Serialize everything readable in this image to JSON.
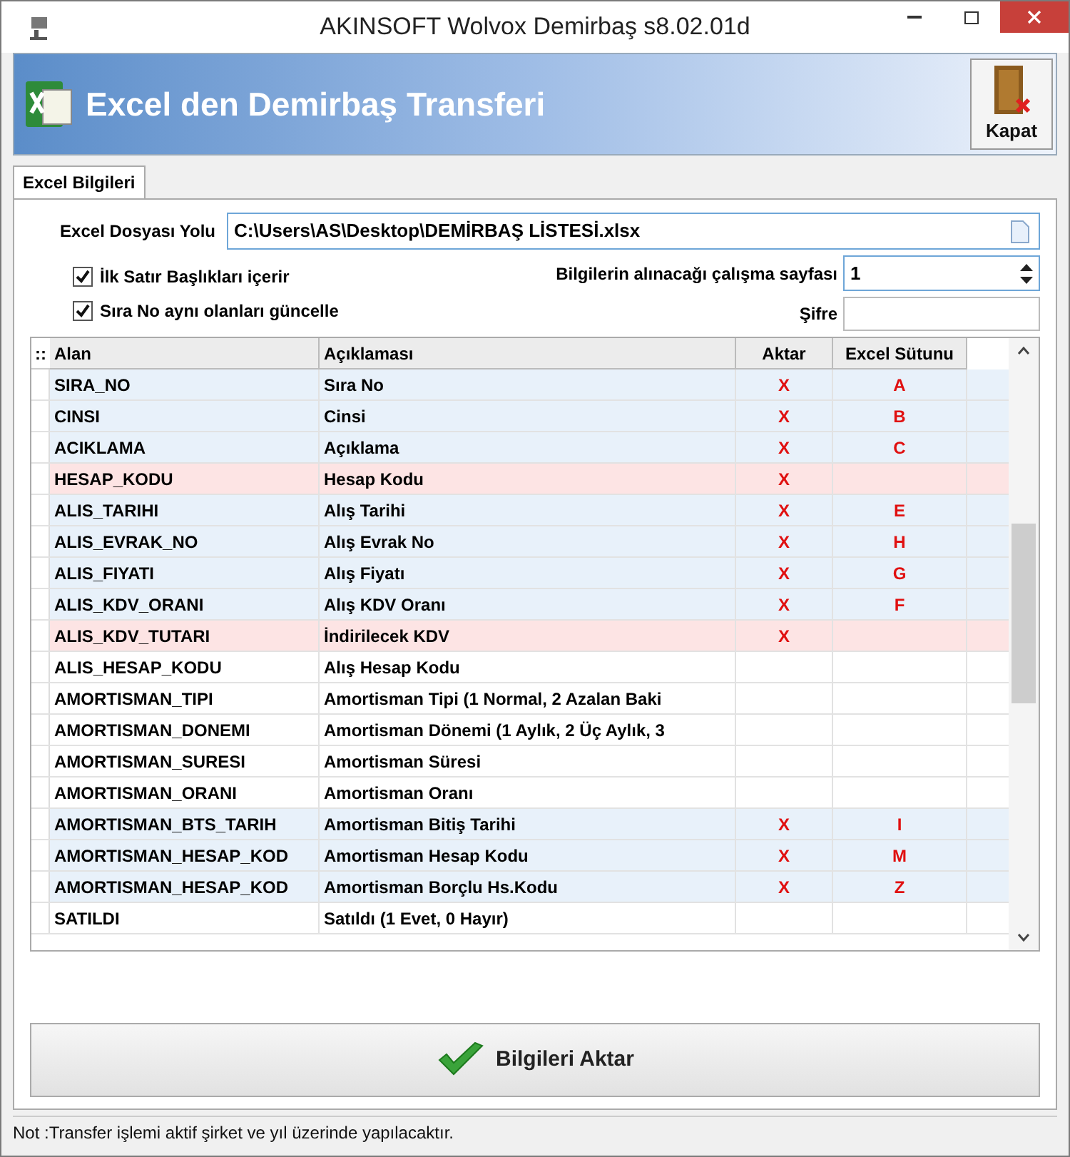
{
  "window": {
    "title": "AKINSOFT Wolvox Demirbaş s8.02.01d"
  },
  "header": {
    "title": "Excel den Demirbaş Transferi",
    "close_button": "Kapat"
  },
  "tabs": [
    {
      "label": "Excel Bilgileri",
      "selected": true
    }
  ],
  "form": {
    "file_label": "Excel Dosyası Yolu",
    "file_value": "C:\\Users\\AS\\Desktop\\DEMİRBAŞ LİSTESİ.xlsx",
    "options": [
      {
        "label": "İlk Satır Başlıkları içerir",
        "checked": true
      },
      {
        "label": "Sıra No aynı olanları güncelle",
        "checked": true
      }
    ],
    "sheet_label": "Bilgilerin alınacağı çalışma sayfası",
    "sheet_value": "1",
    "password_label": "Şifre"
  },
  "table": {
    "indicator": "::",
    "columns": [
      "Alan",
      "Açıklaması",
      "Aktar",
      "Excel Sütunu"
    ],
    "rows": [
      {
        "field": "SIRA_NO",
        "description": "Sıra No",
        "transfer": "X",
        "column": "A",
        "kind": "mapped"
      },
      {
        "field": "CINSI",
        "description": "Cinsi",
        "transfer": "X",
        "column": "B",
        "kind": "mapped"
      },
      {
        "field": "ACIKLAMA",
        "description": "Açıklama",
        "transfer": "X",
        "column": "C",
        "kind": "mapped"
      },
      {
        "field": "HESAP_KODU",
        "description": "Hesap Kodu",
        "transfer": "X",
        "column": "",
        "kind": "missing"
      },
      {
        "field": "ALIS_TARIHI",
        "description": "Alış Tarihi",
        "transfer": "X",
        "column": "E",
        "kind": "mapped"
      },
      {
        "field": "ALIS_EVRAK_NO",
        "description": "Alış Evrak No",
        "transfer": "X",
        "column": "H",
        "kind": "mapped"
      },
      {
        "field": "ALIS_FIYATI",
        "description": "Alış Fiyatı",
        "transfer": "X",
        "column": "G",
        "kind": "mapped"
      },
      {
        "field": "ALIS_KDV_ORANI",
        "description": "Alış KDV Oranı",
        "transfer": "X",
        "column": "F",
        "kind": "mapped"
      },
      {
        "field": "ALIS_KDV_TUTARI",
        "description": "İndirilecek KDV",
        "transfer": "X",
        "column": "",
        "kind": "missing"
      },
      {
        "field": "ALIS_HESAP_KODU",
        "description": "Alış Hesap Kodu",
        "transfer": "",
        "column": "",
        "kind": "none"
      },
      {
        "field": "AMORTISMAN_TIPI",
        "description": "Amortisman Tipi (1 Normal, 2 Azalan Baki",
        "transfer": "",
        "column": "",
        "kind": "none"
      },
      {
        "field": "AMORTISMAN_DONEMI",
        "description": "Amortisman Dönemi (1 Aylık, 2 Üç Aylık, 3",
        "transfer": "",
        "column": "",
        "kind": "none"
      },
      {
        "field": "AMORTISMAN_SURESI",
        "description": "Amortisman Süresi",
        "transfer": "",
        "column": "",
        "kind": "none"
      },
      {
        "field": "AMORTISMAN_ORANI",
        "description": "Amortisman Oranı",
        "transfer": "",
        "column": "",
        "kind": "none"
      },
      {
        "field": "AMORTISMAN_BTS_TARIH",
        "description": "Amortisman Bitiş Tarihi",
        "transfer": "X",
        "column": "I",
        "kind": "mapped"
      },
      {
        "field": "AMORTISMAN_HESAP_KOD",
        "description": "Amortisman Hesap Kodu",
        "transfer": "X",
        "column": "M",
        "kind": "mapped"
      },
      {
        "field": "AMORTISMAN_HESAP_KOD",
        "description": "Amortisman Borçlu Hs.Kodu",
        "transfer": "X",
        "column": "Z",
        "kind": "mapped"
      },
      {
        "field": "SATILDI",
        "description": "Satıldı (1 Evet, 0 Hayır)",
        "transfer": "",
        "column": "",
        "kind": "none"
      }
    ]
  },
  "action_button": "Bilgileri Aktar",
  "status_bar": "Not :Transfer işlemi aktif şirket ve yıl üzerinde yapılacaktır."
}
